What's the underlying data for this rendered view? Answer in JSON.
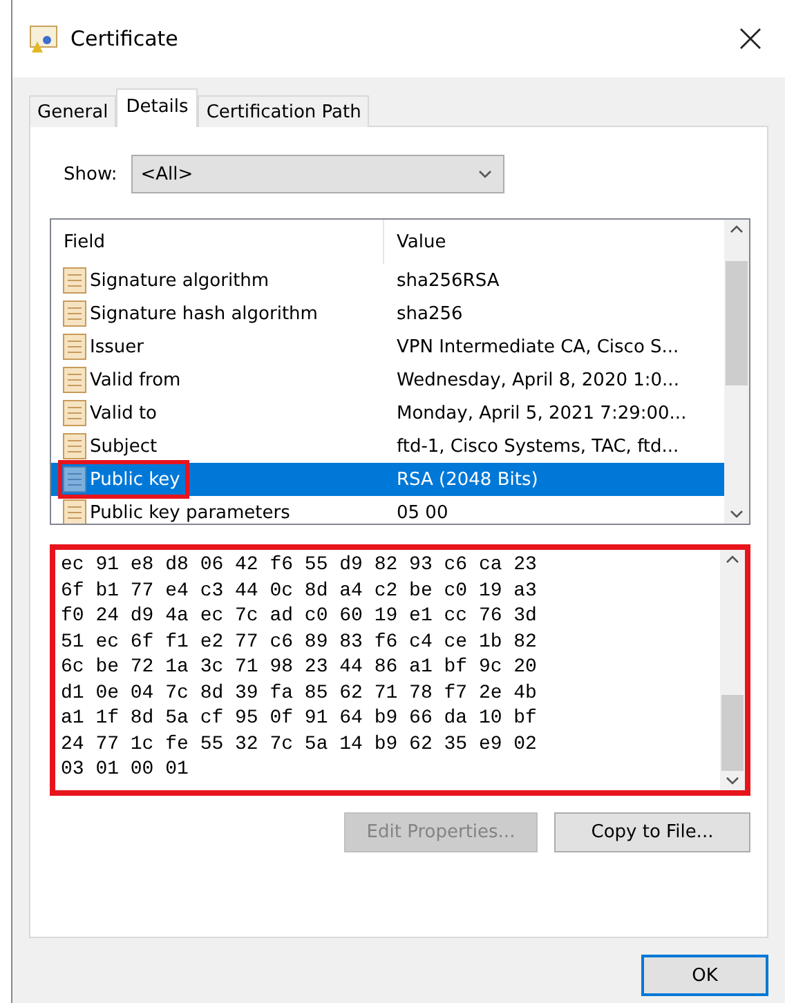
{
  "window": {
    "title": "Certificate"
  },
  "tabs": [
    {
      "label": "General",
      "selected": false
    },
    {
      "label": "Details",
      "selected": true
    },
    {
      "label": "Certification Path",
      "selected": false
    }
  ],
  "show": {
    "label": "Show:",
    "value": "<All>"
  },
  "fields_table": {
    "columns": [
      "Field",
      "Value"
    ],
    "rows": [
      {
        "field": "Signature algorithm",
        "value": "sha256RSA",
        "selected": false,
        "highlighted": false
      },
      {
        "field": "Signature hash algorithm",
        "value": "sha256",
        "selected": false,
        "highlighted": false
      },
      {
        "field": "Issuer",
        "value": "VPN Intermediate CA, Cisco S...",
        "selected": false,
        "highlighted": false
      },
      {
        "field": "Valid from",
        "value": "Wednesday, April 8, 2020 1:0...",
        "selected": false,
        "highlighted": false
      },
      {
        "field": "Valid to",
        "value": "Monday, April 5, 2021 7:29:00...",
        "selected": false,
        "highlighted": false
      },
      {
        "field": "Subject",
        "value": "ftd-1, Cisco Systems, TAC, ftd...",
        "selected": false,
        "highlighted": false
      },
      {
        "field": "Public key",
        "value": "RSA (2048 Bits)",
        "selected": true,
        "highlighted": true
      },
      {
        "field": "Public key parameters",
        "value": "05 00",
        "selected": false,
        "highlighted": false
      }
    ]
  },
  "value_box": {
    "highlighted": true,
    "lines": [
      "ec 91 e8 d8 06 42 f6 55 d9 82 93 c6 ca 23",
      "6f b1 77 e4 c3 44 0c 8d a4 c2 be c0 19 a3",
      "f0 24 d9 4a ec 7c ad c0 60 19 e1 cc 76 3d",
      "51 ec 6f f1 e2 77 c6 89 83 f6 c4 ce 1b 82",
      "6c be 72 1a 3c 71 98 23 44 86 a1 bf 9c 20",
      "d1 0e 04 7c 8d 39 fa 85 62 71 78 f7 2e 4b",
      "a1 1f 8d 5a cf 95 0f 91 64 b9 66 da 10 bf",
      "24 77 1c fe 55 32 7c 5a 14 b9 62 35 e9 02",
      "03 01 00 01"
    ]
  },
  "buttons": [
    {
      "label": "Edit Properties...",
      "disabled": true
    },
    {
      "label": "Copy to File...",
      "disabled": false
    }
  ],
  "ok_button": {
    "label": "OK"
  }
}
